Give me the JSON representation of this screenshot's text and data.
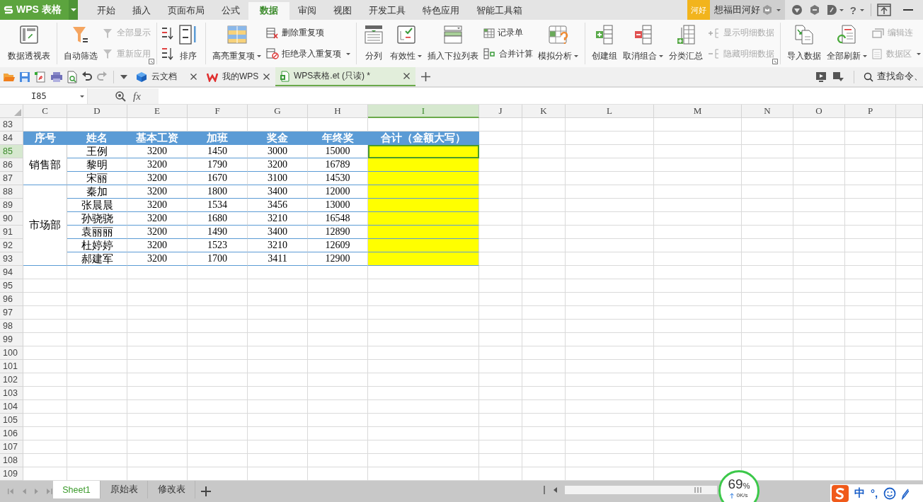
{
  "app": {
    "logo": "WPS 表格"
  },
  "menu_tabs": [
    {
      "label": "开始",
      "selected": false
    },
    {
      "label": "插入",
      "selected": false
    },
    {
      "label": "页面布局",
      "selected": false
    },
    {
      "label": "公式",
      "selected": false
    },
    {
      "label": "数据",
      "selected": true
    },
    {
      "label": "审阅",
      "selected": false
    },
    {
      "label": "视图",
      "selected": false
    },
    {
      "label": "开发工具",
      "selected": false
    },
    {
      "label": "特色应用",
      "selected": false
    },
    {
      "label": "智能工具箱",
      "selected": false
    }
  ],
  "account": {
    "badge": "河好",
    "user": "想福田河好",
    "help": "?"
  },
  "ribbon": [
    {
      "columns": [
        {
          "kind": "large",
          "label": "数据透视表"
        }
      ]
    },
    {
      "launcher": true,
      "columns": [
        {
          "kind": "large",
          "label": "自动筛选"
        },
        {
          "kind": "stack",
          "items": [
            {
              "label": "全部显示",
              "disabled": true
            },
            {
              "label": "重新应用",
              "disabled": true
            }
          ]
        }
      ]
    },
    {
      "columns": [
        {
          "kind": "sort",
          "label": "排序"
        }
      ]
    },
    {
      "columns": [
        {
          "kind": "large",
          "label": "高亮重复项",
          "dropdown": true
        },
        {
          "kind": "stack",
          "items": [
            {
              "label": "删除重复项",
              "disabled": false
            },
            {
              "label": "拒绝录入重复项",
              "disabled": false,
              "dropdown": true
            }
          ]
        }
      ]
    },
    {
      "columns": [
        {
          "kind": "large",
          "label": "分列"
        },
        {
          "kind": "large",
          "label": "有效性",
          "dropdown": true
        },
        {
          "kind": "large",
          "label": "插入下拉列表"
        },
        {
          "kind": "stack",
          "items": [
            {
              "label": "记录单",
              "disabled": false
            },
            {
              "label": "合并计算",
              "disabled": false
            }
          ]
        },
        {
          "kind": "large",
          "label": "模拟分析",
          "dropdown": true
        }
      ]
    },
    {
      "launcher": true,
      "columns": [
        {
          "kind": "large",
          "label": "创建组"
        },
        {
          "kind": "large",
          "label": "取消组合",
          "dropdown": true
        },
        {
          "kind": "large",
          "label": "分类汇总"
        },
        {
          "kind": "stack",
          "items": [
            {
              "label": "显示明细数据",
              "disabled": true
            },
            {
              "label": "隐藏明细数据",
              "disabled": true
            }
          ]
        }
      ]
    },
    {
      "columns": [
        {
          "kind": "large",
          "label": "导入数据"
        },
        {
          "kind": "large",
          "label": "全部刷新",
          "dropdown": true
        },
        {
          "kind": "stack",
          "items": [
            {
              "label": "编辑连",
              "disabled": true
            },
            {
              "label": "数据区",
              "disabled": true,
              "dropdown": true
            }
          ]
        }
      ]
    }
  ],
  "doc_tabs": [
    {
      "label": "云文档",
      "selected": false
    },
    {
      "label": "我的WPS",
      "selected": false
    },
    {
      "label": "WPS表格.et (只读) *",
      "selected": true
    }
  ],
  "search": {
    "placeholder": "查找命令、"
  },
  "formula_bar": {
    "cell_ref": "I85",
    "function_label": "fx"
  },
  "columns": [
    {
      "label": "C",
      "selected": false
    },
    {
      "label": "D",
      "selected": false
    },
    {
      "label": "E",
      "selected": false
    },
    {
      "label": "F",
      "selected": false
    },
    {
      "label": "G",
      "selected": false
    },
    {
      "label": "H",
      "selected": false
    },
    {
      "label": "I",
      "selected": true
    },
    {
      "label": "J",
      "selected": false
    },
    {
      "label": "K",
      "selected": false
    },
    {
      "label": "L",
      "selected": false
    },
    {
      "label": "M",
      "selected": false
    },
    {
      "label": "N",
      "selected": false
    },
    {
      "label": "O",
      "selected": false
    },
    {
      "label": "P",
      "selected": false
    }
  ],
  "rows": [
    {
      "label": "83",
      "selected": false
    },
    {
      "label": "84",
      "selected": false
    },
    {
      "label": "85",
      "selected": true
    },
    {
      "label": "86",
      "selected": false
    },
    {
      "label": "87",
      "selected": false
    },
    {
      "label": "88",
      "selected": false
    },
    {
      "label": "89",
      "selected": false
    },
    {
      "label": "90",
      "selected": false
    },
    {
      "label": "91",
      "selected": false
    },
    {
      "label": "92",
      "selected": false
    },
    {
      "label": "93",
      "selected": false
    },
    {
      "label": "94",
      "selected": false
    },
    {
      "label": "95",
      "selected": false
    },
    {
      "label": "96",
      "selected": false
    },
    {
      "label": "97",
      "selected": false
    },
    {
      "label": "98",
      "selected": false
    },
    {
      "label": "99",
      "selected": false
    },
    {
      "label": "100",
      "selected": false
    },
    {
      "label": "101",
      "selected": false
    },
    {
      "label": "102",
      "selected": false
    },
    {
      "label": "103",
      "selected": false
    },
    {
      "label": "104",
      "selected": false
    },
    {
      "label": "105",
      "selected": false
    },
    {
      "label": "106",
      "selected": false
    },
    {
      "label": "107",
      "selected": false
    },
    {
      "label": "108",
      "selected": false
    },
    {
      "label": "109",
      "selected": false
    }
  ],
  "table": {
    "header": [
      "序号",
      "姓名",
      "基本工资",
      "加班",
      "奖金",
      "年终奖",
      "合计（金额大写）"
    ],
    "groups": [
      {
        "dept": "销售部",
        "rows": [
          {
            "name": "王例",
            "values": [
              "3200",
              "1450",
              "3000",
              "15000"
            ],
            "highlighted": true,
            "active": true
          },
          {
            "name": "黎明",
            "values": [
              "3200",
              "1790",
              "3200",
              "16789"
            ],
            "highlighted": true,
            "active": false
          },
          {
            "name": "宋丽",
            "values": [
              "3200",
              "1670",
              "3100",
              "14530"
            ],
            "highlighted": true,
            "active": false
          }
        ]
      },
      {
        "dept": "市场部",
        "rows": [
          {
            "name": "秦加",
            "values": [
              "3200",
              "1800",
              "3400",
              "12000"
            ],
            "highlighted": true,
            "active": false
          },
          {
            "name": "张晨晨",
            "values": [
              "3200",
              "1534",
              "3456",
              "13000"
            ],
            "highlighted": true,
            "active": false
          },
          {
            "name": "孙骁骁",
            "values": [
              "3200",
              "1680",
              "3210",
              "16548"
            ],
            "highlighted": true,
            "active": false
          },
          {
            "name": "袁丽丽",
            "values": [
              "3200",
              "1490",
              "3400",
              "12890"
            ],
            "highlighted": true,
            "active": false
          },
          {
            "name": "杜婷婷",
            "values": [
              "3200",
              "1523",
              "3210",
              "12609"
            ],
            "highlighted": true,
            "active": false
          },
          {
            "name": "郝建军",
            "values": [
              "3200",
              "1700",
              "3411",
              "12900"
            ],
            "highlighted": true,
            "active": false
          }
        ]
      }
    ]
  },
  "sheet_tabs": [
    {
      "label": "Sheet1",
      "selected": true
    },
    {
      "label": "原始表",
      "selected": false
    },
    {
      "label": "修改表",
      "selected": false
    }
  ],
  "network_widget": {
    "value": "69",
    "unit": "%",
    "speed": "0K/s"
  },
  "ime_bar": {
    "items": [
      "中",
      "°,"
    ]
  }
}
